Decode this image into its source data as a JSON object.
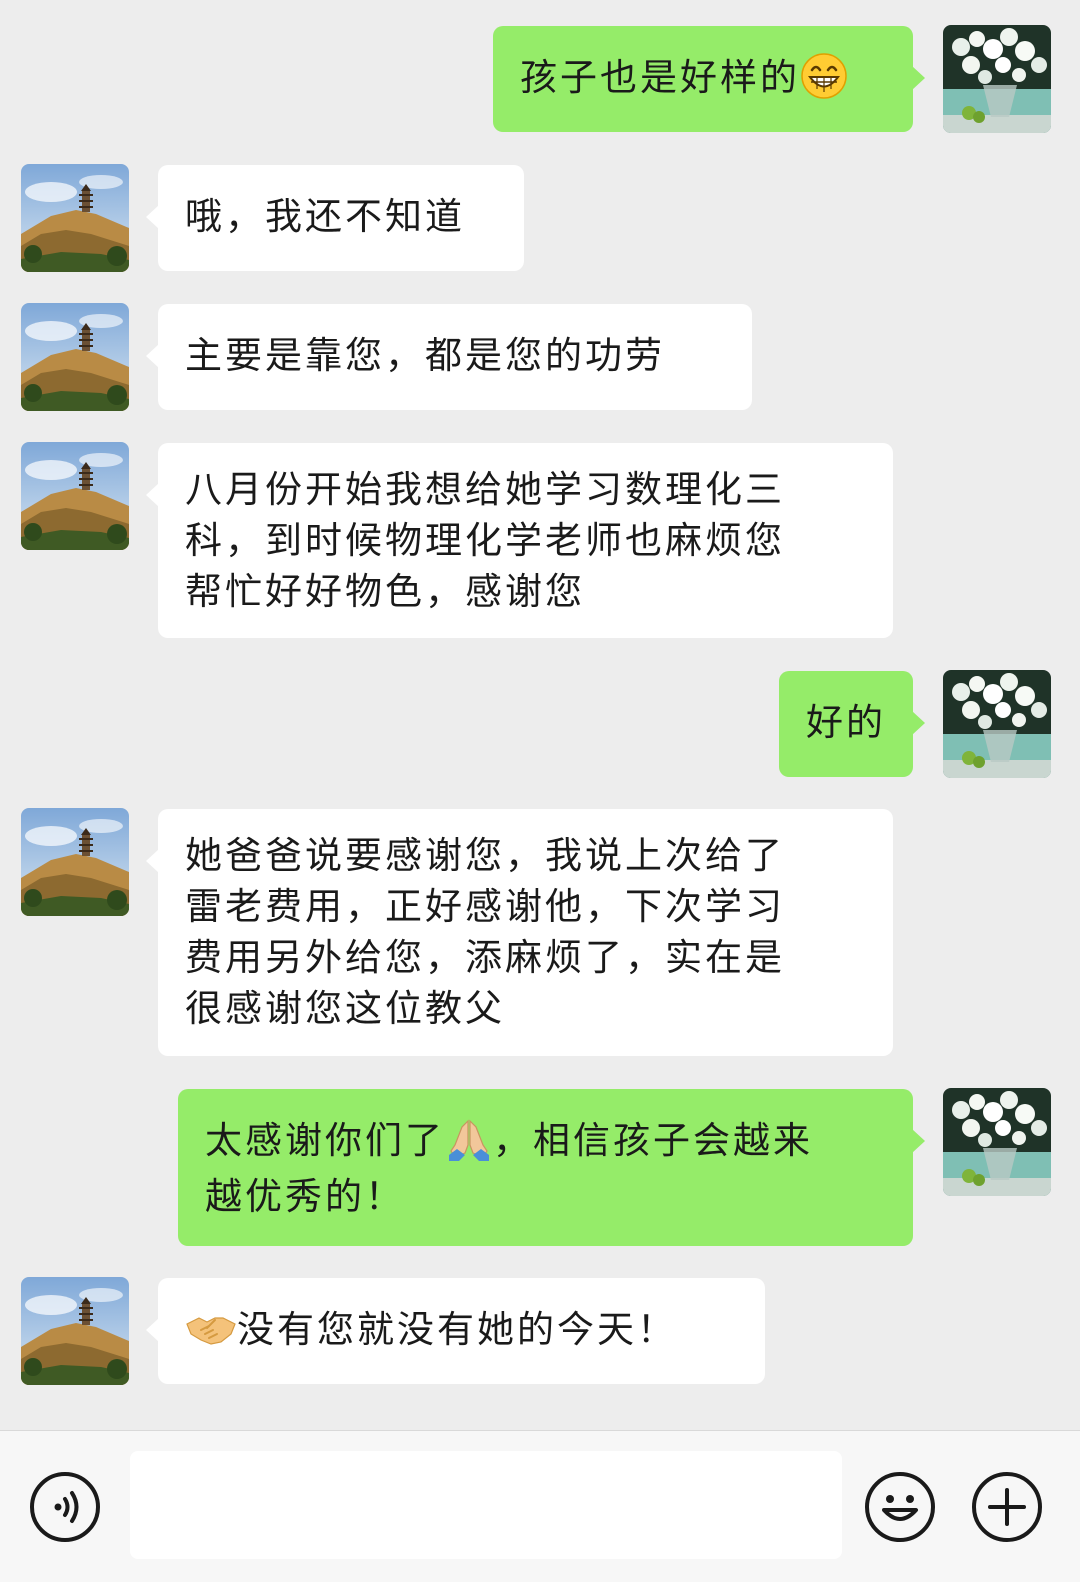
{
  "messages": [
    {
      "side": "out",
      "text": "孩子也是好样的",
      "emoji": "grinning-face-emoji"
    },
    {
      "side": "in",
      "text": "哦，我还不知道"
    },
    {
      "side": "in",
      "text": "主要是靠您，都是您的功劳"
    },
    {
      "side": "in",
      "lines": [
        "八月份开始我想给她学习数理化三",
        "科，到时候物理化学老师也麻烦您",
        "帮忙好好物色，感谢您"
      ]
    },
    {
      "side": "out",
      "text": "好的"
    },
    {
      "side": "in",
      "lines": [
        "她爸爸说要感谢您，我说上次给了",
        "雷老费用，正好感谢他，下次学习",
        "费用另外给您，添麻烦了，实在是",
        "很感谢您这位教父"
      ]
    },
    {
      "side": "out",
      "line1_before": "太感谢你们了",
      "emoji": "folded-hands-emoji",
      "line1_after": "，相信孩子会越来",
      "line2": "越优秀的！"
    },
    {
      "side": "in",
      "emoji": "handshake-emoji",
      "text": "没有您就没有她的今天！"
    }
  ],
  "input_bar": {
    "placeholder": "",
    "icons": [
      "voice-icon",
      "emoji-icon",
      "plus-icon"
    ]
  },
  "colors": {
    "background": "#ededed",
    "bubble_in": "#ffffff",
    "bubble_out": "#95ec69",
    "text": "#1a1a1a"
  }
}
